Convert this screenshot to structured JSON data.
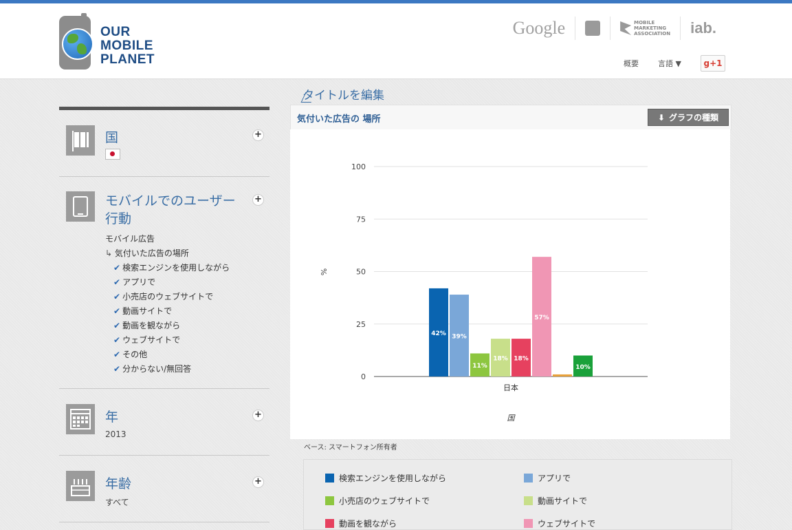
{
  "header": {
    "logo_lines": [
      "OUR",
      "MOBILE",
      "PLANET"
    ],
    "partners": {
      "google": "Google",
      "mma": [
        "MOBILE",
        "MARKETING",
        "ASSOCIATION"
      ],
      "iab": "iab."
    },
    "nav": {
      "overview": "概要",
      "language": "言語",
      "language_arrow": "▼",
      "gplus": "g+1"
    }
  },
  "sidebar": {
    "country": {
      "title": "国"
    },
    "behavior": {
      "title_line1": "モバイルでのユーザー",
      "title_line2": "行動",
      "category": "モバイル広告",
      "subcategory": "気付いた広告の場所",
      "options": [
        "検索エンジンを使用しながら",
        "アプリで",
        "小売店のウェブサイトで",
        "動画サイトで",
        "動画を観ながら",
        "ウェブサイトで",
        "その他",
        "分からない/無回答"
      ]
    },
    "year": {
      "title": "年",
      "value": "2013"
    },
    "age": {
      "title": "年齢",
      "value": "すべて"
    }
  },
  "edit_title": "タイトルを編集",
  "chart_header": {
    "title": "気付いた広告の 場所",
    "type_button": "グラフの種類"
  },
  "base_note": "ベース: スマートフォン所有者",
  "chart_data": {
    "type": "bar",
    "categories": [
      "日本"
    ],
    "series": [
      {
        "name": "検索エンジンを使用しながら",
        "values": [
          42
        ],
        "color": "#0a64b0",
        "label": "42%"
      },
      {
        "name": "アプリで",
        "values": [
          39
        ],
        "color": "#7aa7d8",
        "label": "39%"
      },
      {
        "name": "小売店のウェブサイトで",
        "values": [
          11
        ],
        "color": "#8dc63f",
        "label": "11%"
      },
      {
        "name": "動画サイトで",
        "values": [
          18
        ],
        "color": "#c8df8a",
        "label": "18%"
      },
      {
        "name": "動画を観ながら",
        "values": [
          18
        ],
        "color": "#e6415f",
        "label": "18%"
      },
      {
        "name": "ウェブサイトで",
        "values": [
          57
        ],
        "color": "#f096b4",
        "label": "57%"
      },
      {
        "name": "その他",
        "values": [
          1
        ],
        "color": "#e8a13a",
        "label": ""
      },
      {
        "name": "分からない/無回答",
        "values": [
          10
        ],
        "color": "#1aa13a",
        "label": "10%"
      }
    ],
    "yticks": [
      0,
      25,
      50,
      75,
      100
    ],
    "ylim": [
      0,
      100
    ],
    "ylabel": "%",
    "xlabel": "国",
    "grid": true
  },
  "legend_visible": [
    {
      "label": "検索エンジンを使用しながら",
      "color": "#0a64b0"
    },
    {
      "label": "アプリで",
      "color": "#7aa7d8"
    },
    {
      "label": "小売店のウェブサイトで",
      "color": "#8dc63f"
    },
    {
      "label": "動画サイトで",
      "color": "#c8df8a"
    },
    {
      "label": "動画を観ながら",
      "color": "#e6415f"
    },
    {
      "label": "ウェブサイトで",
      "color": "#f096b4"
    }
  ]
}
